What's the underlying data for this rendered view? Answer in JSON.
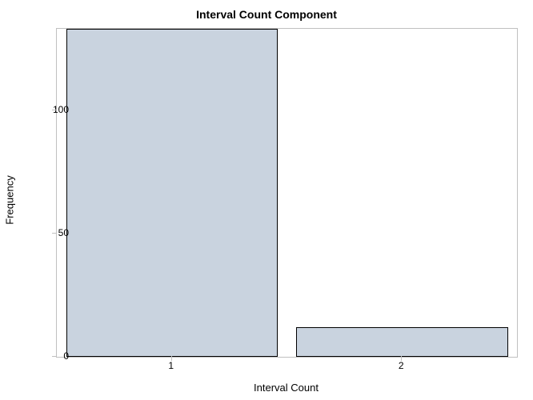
{
  "chart_data": {
    "type": "bar",
    "title": "Interval Count Component",
    "xlabel": "Interval Count",
    "ylabel": "Frequency",
    "categories": [
      "1",
      "2"
    ],
    "values": [
      133,
      12
    ],
    "ylim": [
      0,
      133
    ],
    "yticks": [
      0,
      50,
      100
    ],
    "colors": {
      "bar_fill": "#c9d3df",
      "bar_stroke": "#000000"
    }
  }
}
